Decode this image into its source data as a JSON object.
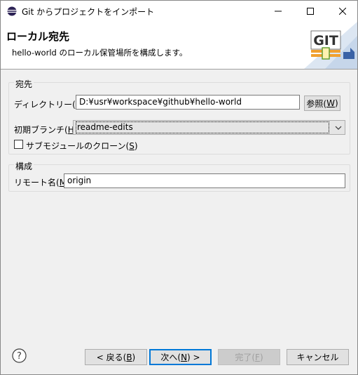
{
  "window": {
    "title": "Git からプロジェクトをインポート",
    "minimize_glyph": "—",
    "maximize_glyph": "☐",
    "close_glyph": "✕"
  },
  "banner": {
    "title": "ローカル宛先",
    "description": "hello-world のローカル保管場所を構成します。",
    "logo_text": "GIT"
  },
  "destination": {
    "group_title": "宛先",
    "directory_label": "ディレクトリー(",
    "directory_mnemonic": "D",
    "directory_label_end": "):",
    "directory_value": "D:¥usr¥workspace¥github¥hello-world",
    "browse_label": "参照(",
    "browse_mnemonic": "W",
    "browse_label_end": ")",
    "branch_label": "初期ブランチ(",
    "branch_mnemonic": "H",
    "branch_label_end": "):",
    "branch_value": "readme-edits",
    "clone_submodules_label": "サブモジュールのクローン(",
    "clone_submodules_mnemonic": "S",
    "clone_submodules_label_end": ")",
    "clone_submodules_checked": false
  },
  "configuration": {
    "group_title": "構成",
    "remote_label": "リモート名(",
    "remote_mnemonic": "M",
    "remote_label_end": "):",
    "remote_value": "origin"
  },
  "footer": {
    "back": "< 戻る(",
    "back_mnemonic": "B",
    "back_end": ")",
    "next": "次へ(",
    "next_mnemonic": "N",
    "next_end": ") >",
    "finish": "完了(",
    "finish_mnemonic": "F",
    "finish_end": ")",
    "cancel": "キャンセル"
  },
  "colors": {
    "accent": "#0078d7",
    "logo_green": "#5a9a2a",
    "logo_orange": "#f0a030"
  }
}
